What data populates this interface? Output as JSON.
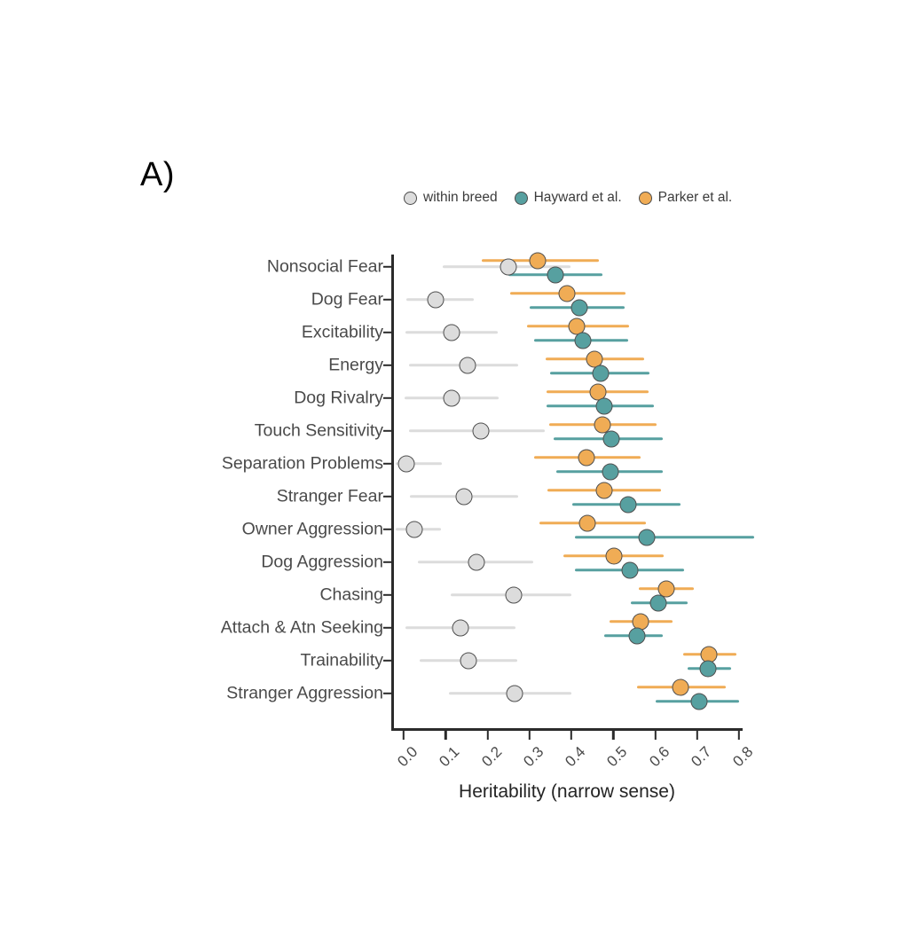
{
  "panel": {
    "label": "A)"
  },
  "legend": {
    "position": "top",
    "entries": [
      {
        "name": "within breed",
        "color": "#dcdcdc"
      },
      {
        "name": "Hayward et al.",
        "color": "#57a0a0"
      },
      {
        "name": "Parker et al.",
        "color": "#f0ac55"
      }
    ]
  },
  "chart_data": {
    "type": "scatter",
    "title": "",
    "subtitle": "",
    "xlabel": "Heritability (narrow sense)",
    "ylabel": "",
    "xlim": [
      0.0,
      0.8
    ],
    "ylim": null,
    "grid": false,
    "legend_position": "top",
    "xticks": [
      "0.0",
      "0.1",
      "0.2",
      "0.3",
      "0.4",
      "0.5",
      "0.6",
      "0.7",
      "0.8"
    ],
    "xtick_values": [
      0.0,
      0.1,
      0.2,
      0.3,
      0.4,
      0.5,
      0.6,
      0.7,
      0.8
    ],
    "categories": [
      "Nonsocial Fear",
      "Dog Fear",
      "Excitability",
      "Energy",
      "Dog Rivalry",
      "Touch Sensitivity",
      "Separation Problems",
      "Stranger Fear",
      "Owner Aggression",
      "Dog Aggression",
      "Chasing",
      "Attach & Atn Seeking",
      "Trainability",
      "Stranger Aggression"
    ],
    "series": [
      {
        "name": "within breed",
        "color": "#dcdcdc",
        "values": [
          0.25,
          0.076,
          0.114,
          0.152,
          0.114,
          0.184,
          0.007,
          0.143,
          0.026,
          0.173,
          0.262,
          0.135,
          0.154,
          0.264
        ],
        "ci_low": [
          0.094,
          0.006,
          0.004,
          0.012,
          0.002,
          0.013,
          -0.02,
          0.015,
          -0.02,
          0.033,
          0.113,
          0.004,
          0.038,
          0.108
        ],
        "ci_high": [
          0.398,
          0.168,
          0.224,
          0.272,
          0.226,
          0.337,
          0.09,
          0.272,
          0.089,
          0.308,
          0.4,
          0.266,
          0.271,
          0.4
        ]
      },
      {
        "name": "Hayward et al.",
        "color": "#57a0a0",
        "values": [
          0.362,
          0.419,
          0.427,
          0.47,
          0.478,
          0.495,
          0.493,
          0.535,
          0.579,
          0.54,
          0.607,
          0.556,
          0.725,
          0.704
        ],
        "ci_low": [
          0.25,
          0.3,
          0.311,
          0.35,
          0.34,
          0.358,
          0.363,
          0.402,
          0.408,
          0.408,
          0.541,
          0.478,
          0.678,
          0.6
        ],
        "ci_high": [
          0.475,
          0.528,
          0.536,
          0.586,
          0.596,
          0.617,
          0.617,
          0.661,
          0.835,
          0.668,
          0.677,
          0.618,
          0.782,
          0.8
        ]
      },
      {
        "name": "Parker et al.",
        "color": "#f0ac55",
        "values": [
          0.319,
          0.389,
          0.412,
          0.456,
          0.463,
          0.474,
          0.436,
          0.478,
          0.438,
          0.501,
          0.626,
          0.566,
          0.727,
          0.661
        ],
        "ci_low": [
          0.186,
          0.255,
          0.295,
          0.339,
          0.34,
          0.348,
          0.311,
          0.342,
          0.324,
          0.381,
          0.561,
          0.49,
          0.666,
          0.556
        ],
        "ci_high": [
          0.465,
          0.53,
          0.537,
          0.573,
          0.585,
          0.603,
          0.565,
          0.613,
          0.577,
          0.62,
          0.692,
          0.641,
          0.793,
          0.769
        ]
      }
    ]
  }
}
